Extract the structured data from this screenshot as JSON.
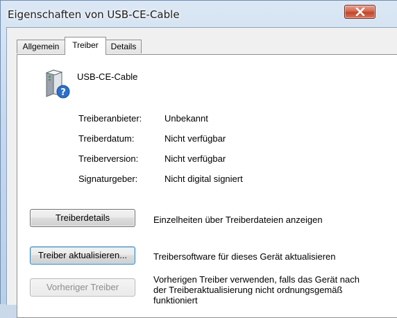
{
  "window": {
    "title": "Eigenschaften von USB-CE-Cable"
  },
  "titlebar": {
    "close_icon": "close-x-icon"
  },
  "tabs": [
    {
      "label": "Allgemein",
      "active": false
    },
    {
      "label": "Treiber",
      "active": true
    },
    {
      "label": "Details",
      "active": false
    }
  ],
  "device": {
    "name": "USB-CE-Cable",
    "icon": "unknown-device-icon"
  },
  "driver_info": [
    {
      "label": "Treiberanbieter:",
      "value": "Unbekannt"
    },
    {
      "label": "Treiberdatum:",
      "value": "Nicht verfügbar"
    },
    {
      "label": "Treiberversion:",
      "value": "Nicht verfügbar"
    },
    {
      "label": "Signaturgeber:",
      "value": "Nicht digital signiert"
    }
  ],
  "actions": [
    {
      "button": "Treiberdetails",
      "description": "Einzelheiten über Treiberdateien anzeigen",
      "enabled": true
    },
    {
      "button": "Treiber aktualisieren...",
      "description": "Treibersoftware für dieses Gerät aktualisieren",
      "enabled": true
    },
    {
      "button": "Vorheriger Treiber",
      "description": "Vorherigen Treiber verwenden, falls das Gerät nach der Treiberaktualisierung nicht ordnungsgemäß funktioniert",
      "enabled": false
    }
  ]
}
